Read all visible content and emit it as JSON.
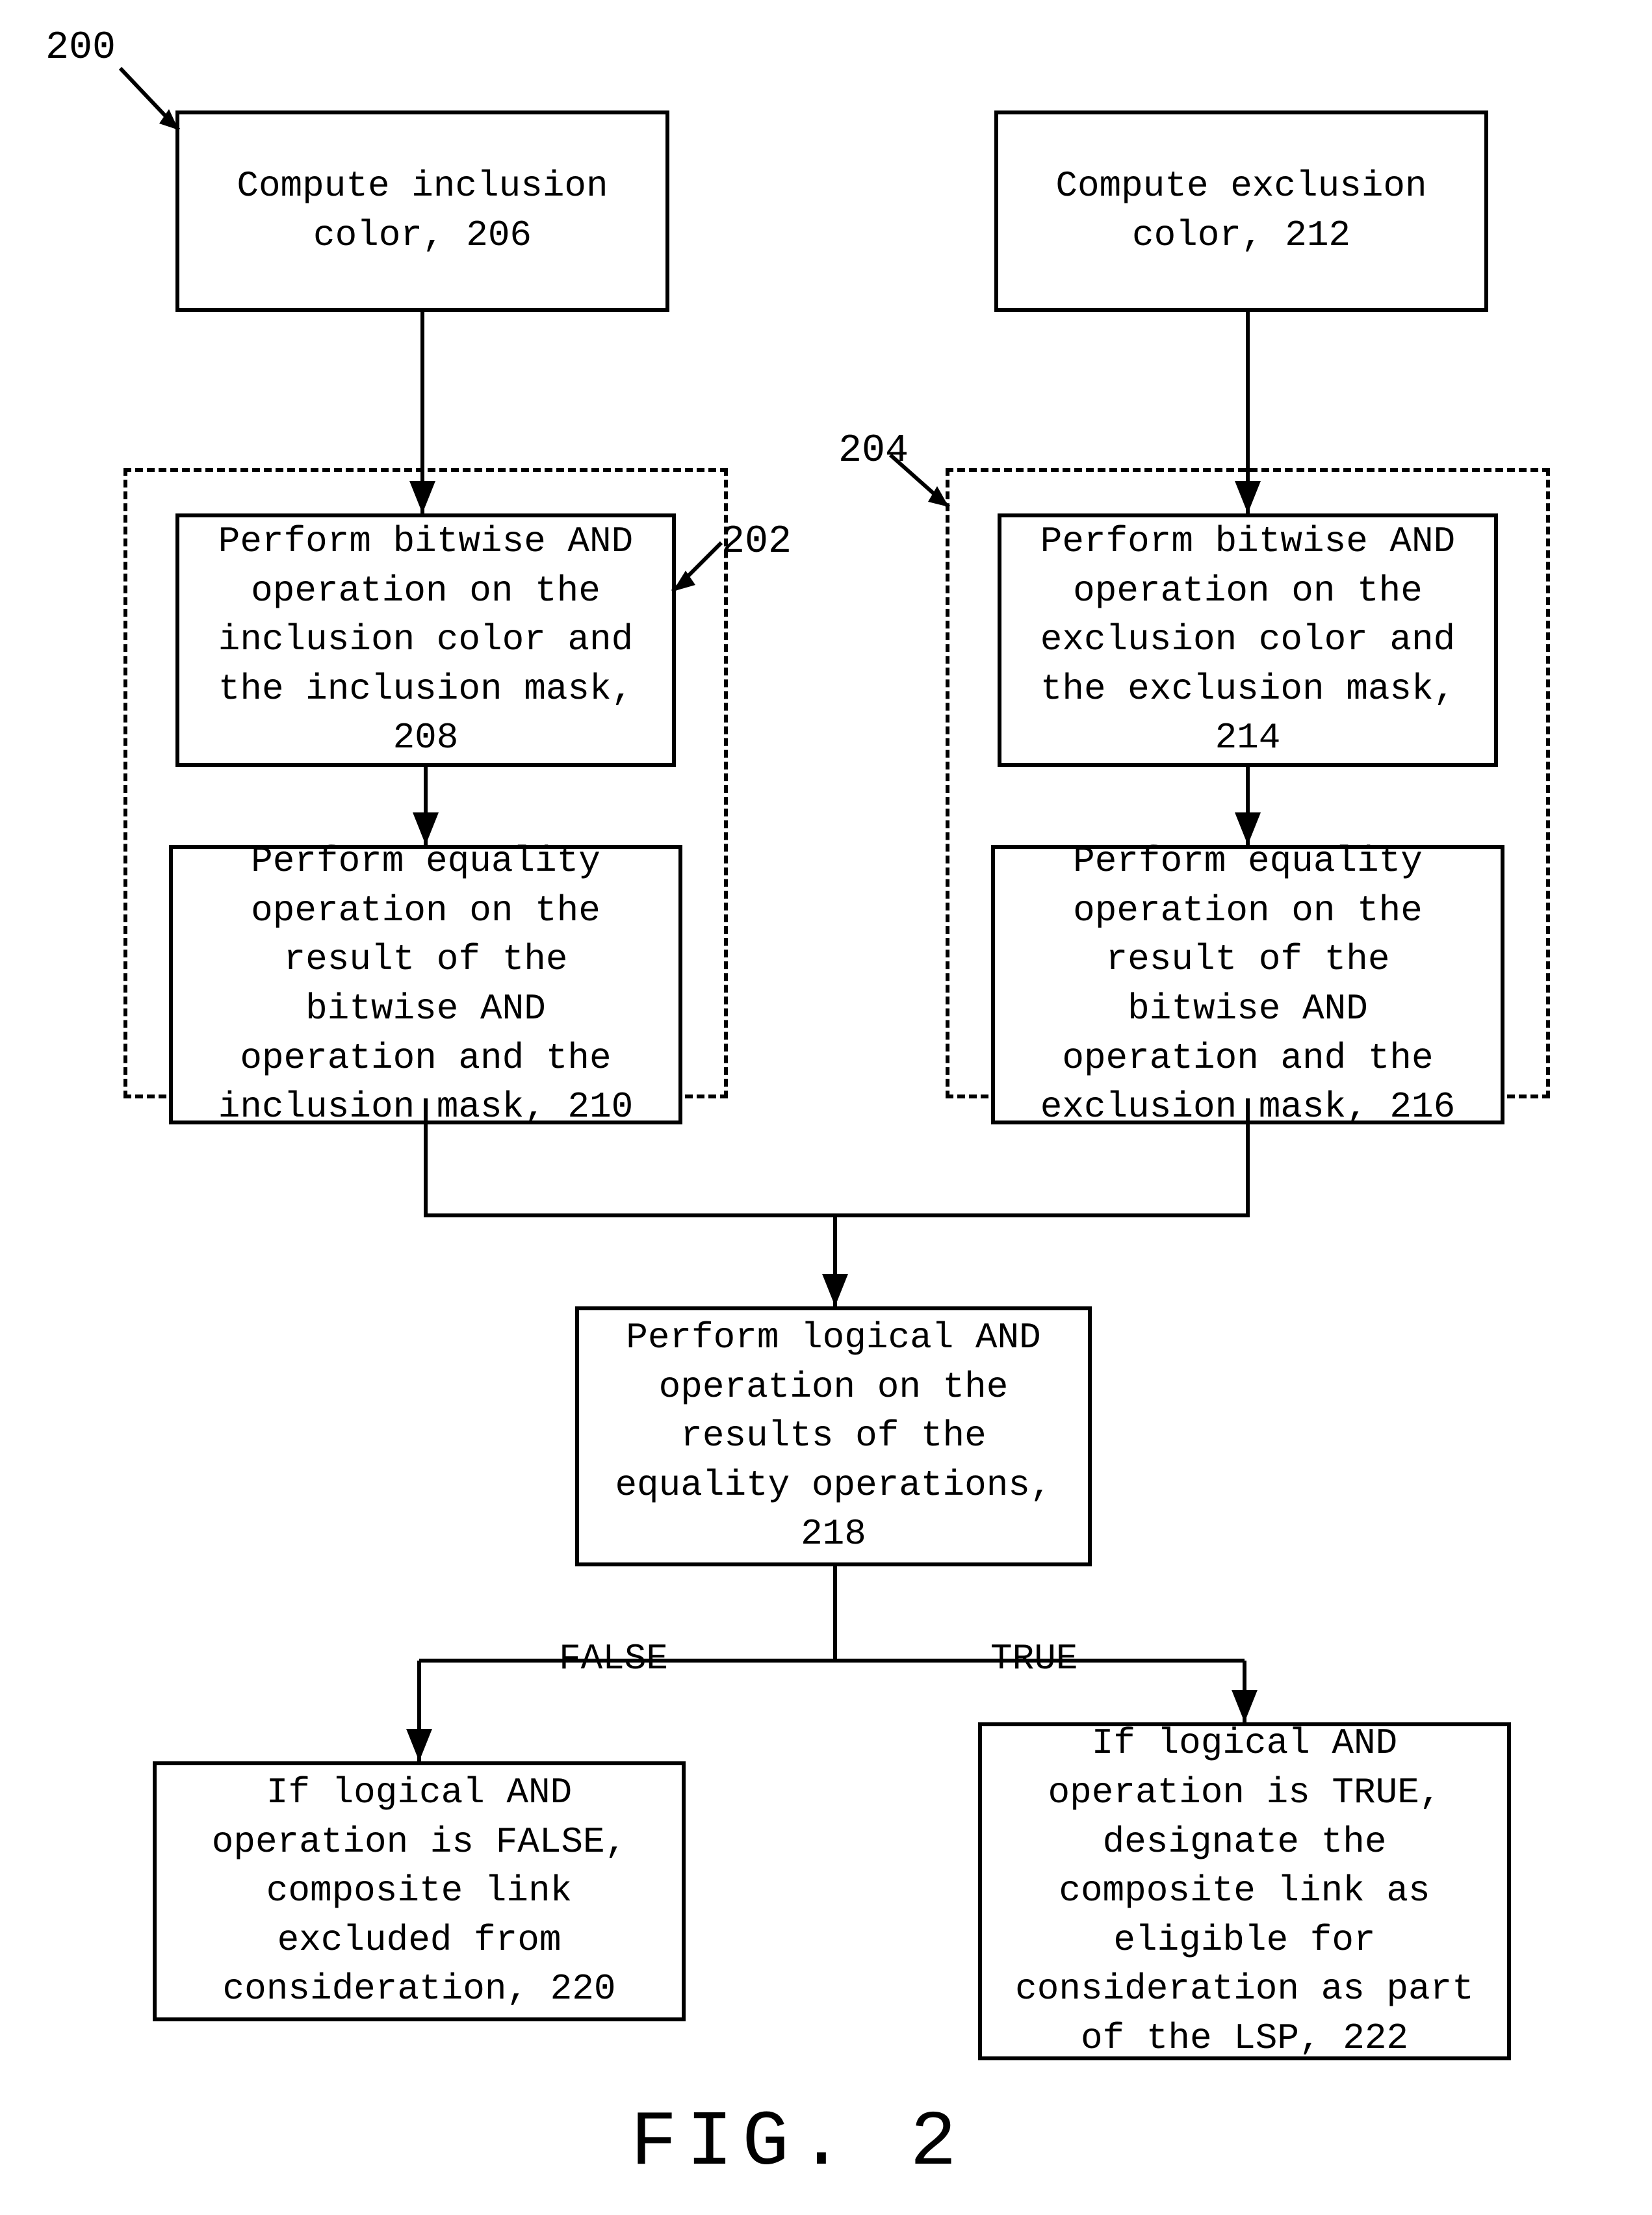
{
  "refs": {
    "r200": "200",
    "r202": "202",
    "r204": "204"
  },
  "boxes": {
    "b206": "Compute inclusion color, 206",
    "b208": "Perform bitwise AND operation on the inclusion color and the inclusion mask, 208",
    "b210": "Perform equality operation on the result of the bitwise AND operation and the inclusion mask, 210",
    "b212": "Compute exclusion color, 212",
    "b214": "Perform bitwise AND operation on the exclusion color and the exclusion mask, 214",
    "b216": "Perform equality operation on the result of the bitwise AND operation and the exclusion mask, 216",
    "b218": "Perform logical AND operation on the results of the equality operations, 218",
    "b220": "If logical AND operation is FALSE, composite link excluded from consideration, 220",
    "b222": "If logical AND operation is TRUE, designate the composite link as eligible for consideration as part of the LSP, 222"
  },
  "labels": {
    "false": "FALSE",
    "true": "TRUE"
  },
  "caption": "FIG. 2"
}
